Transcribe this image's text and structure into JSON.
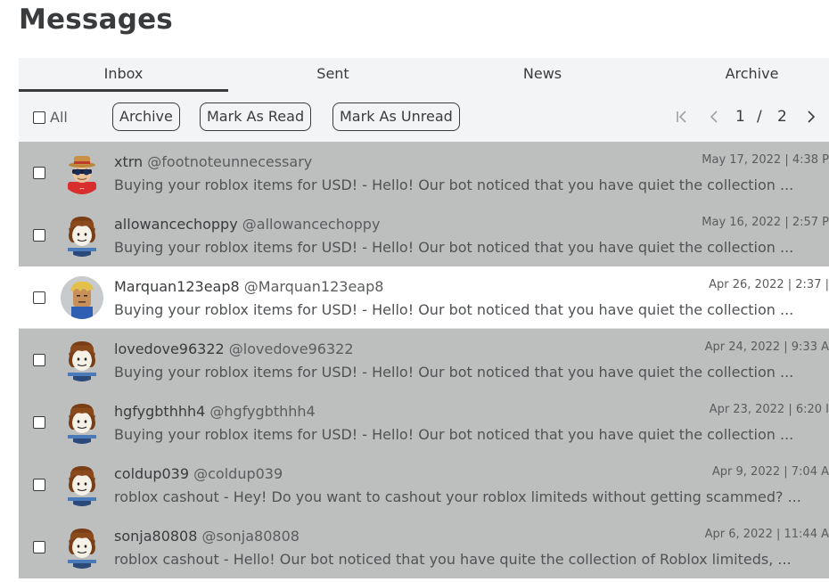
{
  "page": {
    "title": "Messages"
  },
  "tabs": [
    {
      "label": "Inbox",
      "active": true
    },
    {
      "label": "Sent",
      "active": false
    },
    {
      "label": "News",
      "active": false
    },
    {
      "label": "Archive",
      "active": false
    }
  ],
  "toolbar": {
    "select_all_label": "All",
    "archive_label": "Archive",
    "mark_read_label": "Mark As Read",
    "mark_unread_label": "Mark As Unread"
  },
  "pager": {
    "current": "1",
    "separator": "/",
    "total": "2"
  },
  "colors": {
    "row_background": "#bdbebe",
    "row_unread_background": "#ffffff",
    "text": "#393b3d",
    "toolbar_background": "#f2f4f5"
  },
  "messages": [
    {
      "username": "xtrn",
      "handle": "@footnoteunnecessary",
      "date": "May 17, 2022 | 4:38 P",
      "preview": "Buying your roblox items for USD!  - Hello! Our bot noticed that you have quiet the collection ...",
      "avatar": "avatar-hat-sunglasses",
      "highlighted": false
    },
    {
      "username": "allowancechoppy",
      "handle": "@allowancechoppy",
      "date": "May 16, 2022 | 2:57 P",
      "preview": "Buying your roblox items for USD!  - Hello! Our bot noticed that you have quiet the collection ...",
      "avatar": "avatar-default-noob",
      "highlighted": false
    },
    {
      "username": "Marquan123eap8",
      "handle": "@Marquan123eap8",
      "date": "Apr 26, 2022 | 2:37 |",
      "preview": "Buying your roblox items for USD!  - Hello! Our bot noticed that you have quiet the collection ...",
      "avatar": "avatar-blonde-hair",
      "highlighted": true
    },
    {
      "username": "lovedove96322",
      "handle": "@lovedove96322",
      "date": "Apr 24, 2022 | 9:33 A",
      "preview": "Buying your roblox items for USD!  - Hello! Our bot noticed that you have quiet the collection ...",
      "avatar": "avatar-default-noob",
      "highlighted": false
    },
    {
      "username": "hgfygbthhh4",
      "handle": "@hgfygbthhh4",
      "date": "Apr 23, 2022 | 6:20 I",
      "preview": "Buying your roblox items for USD!  - Hello! Our bot noticed that you have quiet the collection ...",
      "avatar": "avatar-default-noob",
      "highlighted": false
    },
    {
      "username": "coldup039",
      "handle": "@coldup039",
      "date": "Apr 9, 2022 | 7:04 A",
      "preview": "roblox cashout  - Hey! Do you want to cashout your roblox limiteds without getting scammed? ...",
      "avatar": "avatar-default-noob",
      "highlighted": false
    },
    {
      "username": "sonja80808",
      "handle": "@sonja80808",
      "date": "Apr 6, 2022 | 11:44 A",
      "preview": "roblox cashout  - Hello! Our bot noticed that you have quite the collection of Roblox limiteds, ...",
      "avatar": "avatar-default-noob",
      "highlighted": false
    }
  ]
}
